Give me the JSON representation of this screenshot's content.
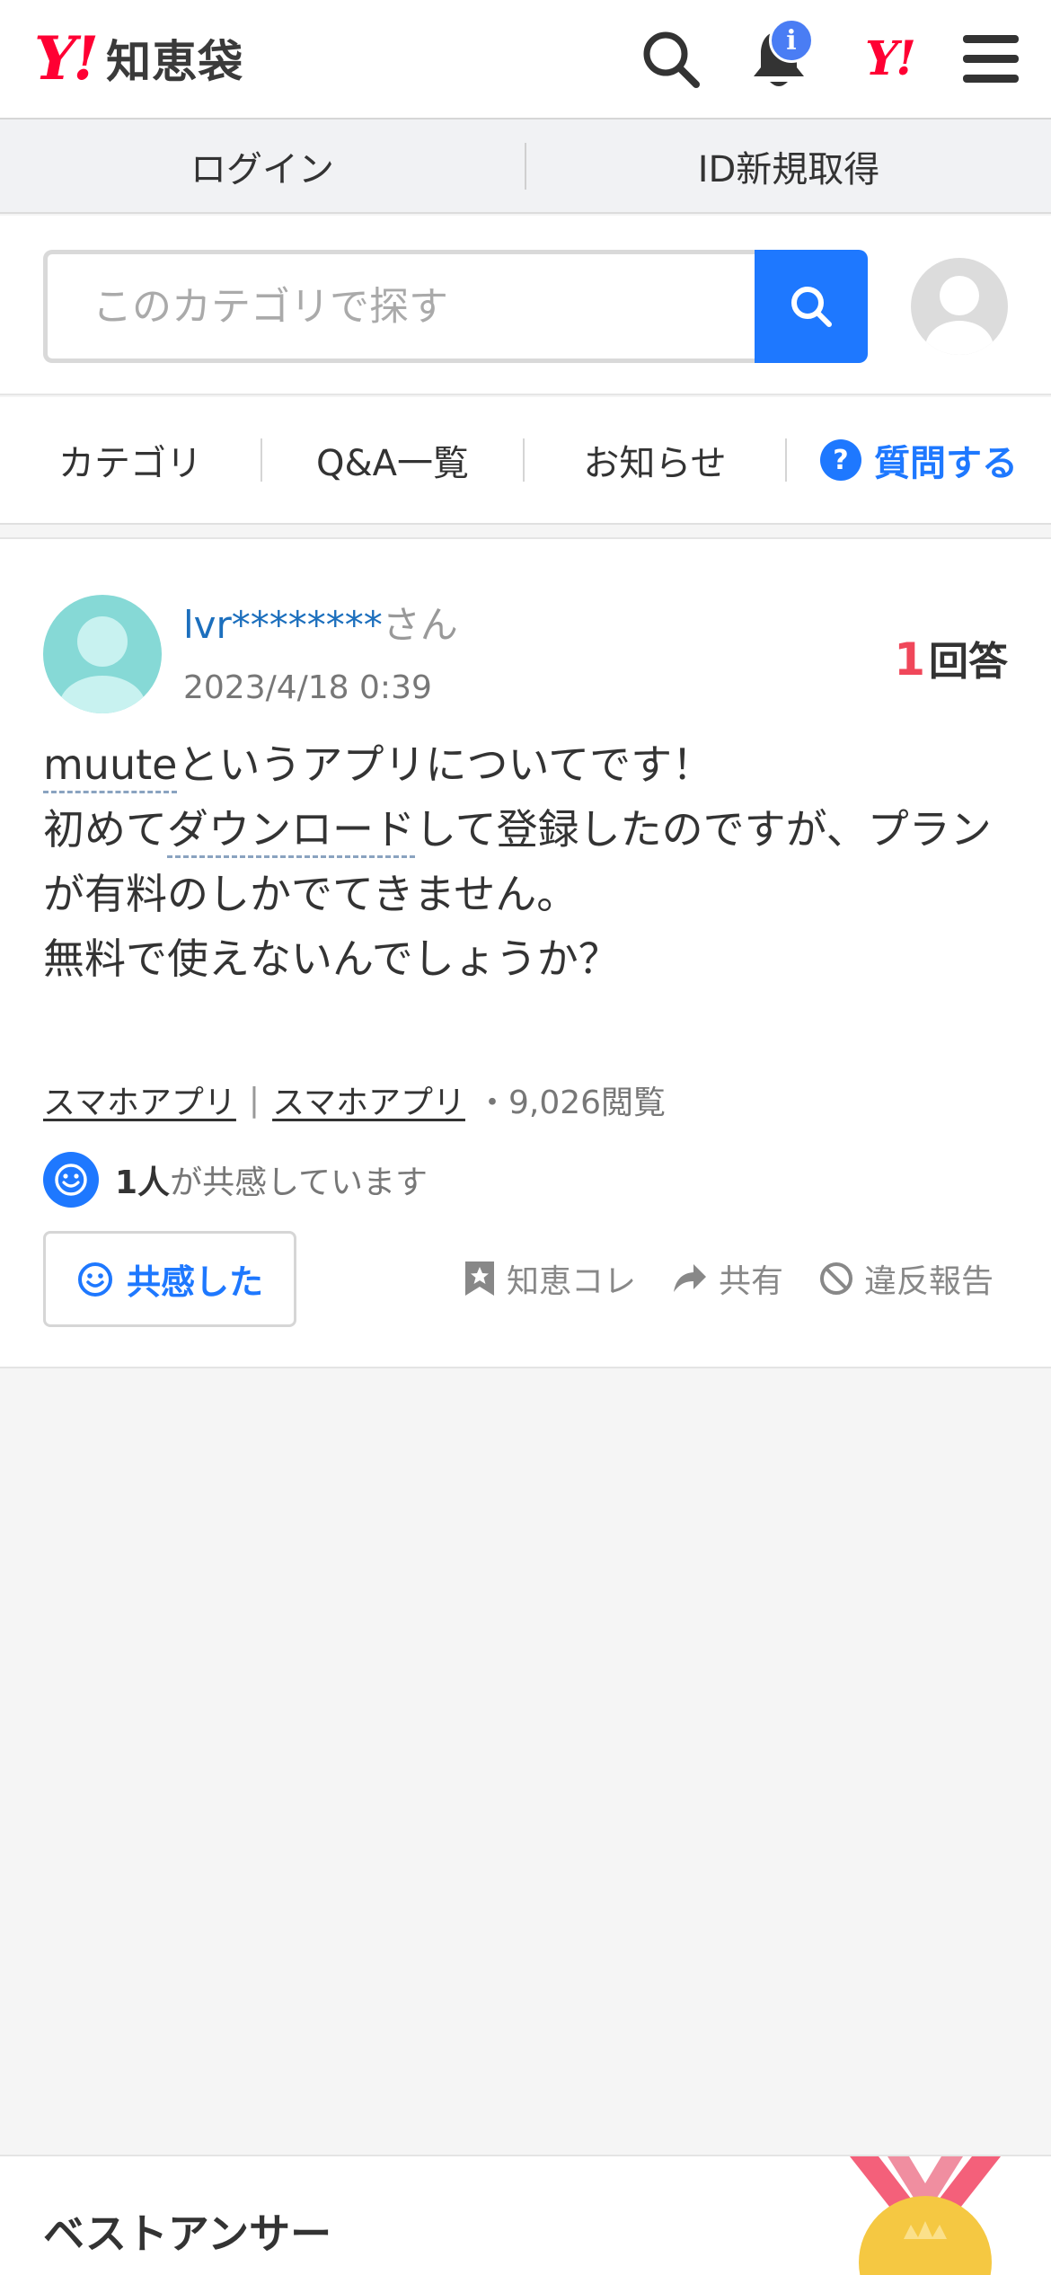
{
  "header": {
    "logo_y": "Y!",
    "logo_text": "知恵袋",
    "notification_badge": "i",
    "yahoo_small": "Y!"
  },
  "loginbar": {
    "login": "ログイン",
    "register": "ID新規取得"
  },
  "search": {
    "placeholder": "このカテゴリで探す"
  },
  "nav": {
    "category": "カテゴリ",
    "qa_list": "Q&A一覧",
    "news": "お知らせ",
    "ask_icon": "?",
    "ask": "質問する"
  },
  "question": {
    "username": "lvr********",
    "username_suffix": "さん",
    "date": "2023/4/18 0:39",
    "answer_count": "1",
    "answer_label": "回答",
    "body_line1_kw": "muute",
    "body_line1_rest": "というアプリについてです！",
    "body_line2_pre": "初めて",
    "body_line2_kw": "ダウンロード",
    "body_line2_rest": "して登録したのですが、プランが有料のしかでてきません。",
    "body_line3": "無料で使えないんでしょうか？",
    "category_1": "スマホアプリ",
    "category_sep": "|",
    "category_2": "スマホアプリ",
    "views": "・9,026閲覧",
    "empathy_count": "1人",
    "empathy_text": "が共感しています",
    "empathy_button": "共感した",
    "action_chiebukuro": "知恵コレ",
    "action_share": "共有",
    "action_report": "違反報告"
  },
  "best_answer": {
    "title": "ベストアンサー"
  },
  "colors": {
    "brand_red": "#ff0033",
    "accent_blue": "#1e78ff",
    "answer_count_red": "#f0475a",
    "username_blue": "#1c6fbd"
  }
}
